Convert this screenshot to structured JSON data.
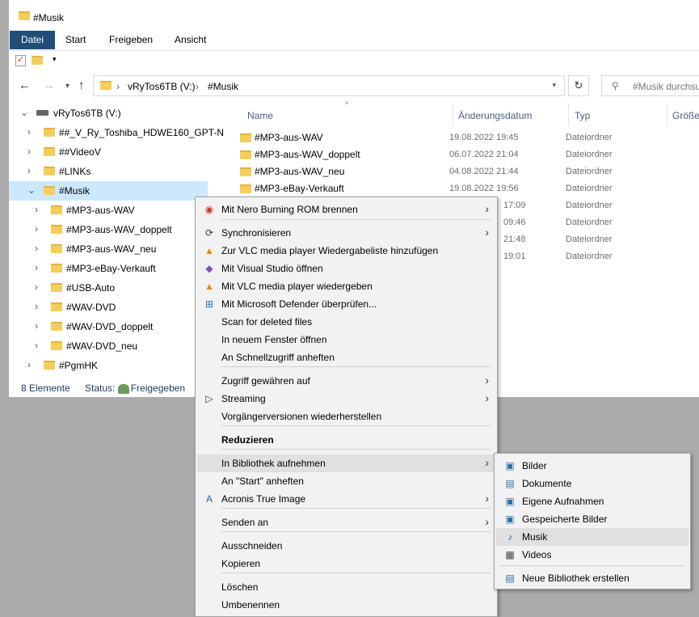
{
  "window": {
    "title": "#Musik"
  },
  "ribbon": {
    "tabs": [
      "Datei",
      "Start",
      "Freigeben",
      "Ansicht"
    ]
  },
  "qat": {
    "dropdown_glyph": "▾"
  },
  "address": {
    "crumbs": [
      "vRyTos6TB (V:)",
      "#Musik"
    ],
    "separator": "›",
    "search_placeholder": "#Musik durchsu"
  },
  "nav": {
    "back": "←",
    "forward": "→",
    "up": "↑",
    "refresh": "↻",
    "search_icon": "⚲"
  },
  "tree": {
    "drive": "vRyTos6TB (V:)",
    "items": [
      {
        "label": "##_V_Ry_Toshiba_HDWE160_GPT-N",
        "level": 1,
        "selected": false
      },
      {
        "label": "##VideoV",
        "level": 1,
        "selected": false
      },
      {
        "label": "#LINKs",
        "level": 1,
        "selected": false
      },
      {
        "label": "#Musik",
        "level": 1,
        "selected": true,
        "expanded": true
      },
      {
        "label": "#MP3-aus-WAV",
        "level": 2,
        "selected": false
      },
      {
        "label": "#MP3-aus-WAV_doppelt",
        "level": 2,
        "selected": false
      },
      {
        "label": "#MP3-aus-WAV_neu",
        "level": 2,
        "selected": false
      },
      {
        "label": "#MP3-eBay-Verkauft",
        "level": 2,
        "selected": false
      },
      {
        "label": "#USB-Auto",
        "level": 2,
        "selected": false
      },
      {
        "label": "#WAV-DVD",
        "level": 2,
        "selected": false
      },
      {
        "label": "#WAV-DVD_doppelt",
        "level": 2,
        "selected": false
      },
      {
        "label": "#WAV-DVD_neu",
        "level": 2,
        "selected": false
      },
      {
        "label": "#PgmHK",
        "level": 1,
        "selected": false
      }
    ]
  },
  "columns": {
    "name": "Name",
    "date": "Änderungsdatum",
    "type": "Typ",
    "size": "Größe"
  },
  "files": [
    {
      "name": "#MP3-aus-WAV",
      "date": "19.08.2022 19:45",
      "type": "Dateiordner"
    },
    {
      "name": "#MP3-aus-WAV_doppelt",
      "date": "06.07.2022 21:04",
      "type": "Dateiordner"
    },
    {
      "name": "#MP3-aus-WAV_neu",
      "date": "04.08.2022 21:44",
      "type": "Dateiordner"
    },
    {
      "name": "#MP3-eBay-Verkauft",
      "date": "19.08.2022 19:56",
      "type": "Dateiordner"
    },
    {
      "name": "",
      "date": "17:09",
      "type": "Dateiordner"
    },
    {
      "name": "",
      "date": "09:46",
      "type": "Dateiordner"
    },
    {
      "name": "",
      "date": "21:48",
      "type": "Dateiordner"
    },
    {
      "name": "",
      "date": "19:01",
      "type": "Dateiordner"
    }
  ],
  "status": {
    "count": "8 Elemente",
    "state": "Status:",
    "state_value": "Freigegeben"
  },
  "context_menu": {
    "items": [
      {
        "label": "Mit Nero Burning ROM brennen",
        "icon": "nero-icon",
        "glyph": "◉",
        "color": "#c0392b",
        "sub": true
      },
      {
        "label": "Synchronisieren",
        "icon": "sync-icon",
        "glyph": "⟳",
        "color": "#333333",
        "sub": true
      },
      {
        "label": "Zur VLC media player Wiedergabeliste hinzufügen",
        "icon": "vlc-icon",
        "glyph": "▲",
        "color": "#f08a00"
      },
      {
        "label": "Mit Visual Studio öffnen",
        "icon": "visual-studio-icon",
        "glyph": "◆",
        "color": "#7b4fc9"
      },
      {
        "label": "Mit VLC media player wiedergeben",
        "icon": "vlc-icon",
        "glyph": "▲",
        "color": "#f08a00"
      },
      {
        "label": "Mit Microsoft Defender überprüfen...",
        "icon": "defender-icon",
        "glyph": "⊞",
        "color": "#1f6fb4"
      },
      {
        "label": "Scan for deleted files"
      },
      {
        "label": "In neuem Fenster öffnen"
      },
      {
        "label": "An Schnellzugriff anheften"
      },
      {
        "label": "Zugriff gewähren auf",
        "sub": true
      },
      {
        "label": "Streaming",
        "icon": "play-icon",
        "glyph": "▷",
        "color": "#333333",
        "sub": true
      },
      {
        "label": "Vorgängerversionen wiederherstellen"
      },
      {
        "label": "Reduzieren",
        "bold": true
      },
      {
        "label": "In Bibliothek aufnehmen",
        "sub": true,
        "highlighted": true
      },
      {
        "label": "An \"Start\" anheften"
      },
      {
        "label": "Acronis True Image",
        "icon": "acronis-icon",
        "glyph": "A",
        "color": "#1d5fb3",
        "sub": true
      },
      {
        "label": "Senden an",
        "sub": true
      },
      {
        "label": "Ausschneiden"
      },
      {
        "label": "Kopieren"
      },
      {
        "label": "Löschen"
      },
      {
        "label": "Umbenennen"
      }
    ]
  },
  "library_submenu": {
    "items": [
      {
        "label": "Bilder",
        "icon": "library-pictures-icon",
        "glyph": "▣",
        "color": "#2f6fa8"
      },
      {
        "label": "Dokumente",
        "icon": "library-documents-icon",
        "glyph": "▤",
        "color": "#2f6fa8"
      },
      {
        "label": "Eigene Aufnahmen",
        "icon": "library-recordings-icon",
        "glyph": "▣",
        "color": "#2f6fa8"
      },
      {
        "label": "Gespeicherte Bilder",
        "icon": "library-saved-pictures-icon",
        "glyph": "▣",
        "color": "#2f6fa8"
      },
      {
        "label": "Musik",
        "icon": "music-note-icon",
        "glyph": "♪",
        "color": "#1f6fb4",
        "highlighted": true
      },
      {
        "label": "Videos",
        "icon": "film-icon",
        "glyph": "▦",
        "color": "#444444"
      },
      {
        "label": "Neue Bibliothek erstellen",
        "icon": "new-library-icon",
        "glyph": "▤",
        "color": "#2f6fa8"
      }
    ]
  }
}
